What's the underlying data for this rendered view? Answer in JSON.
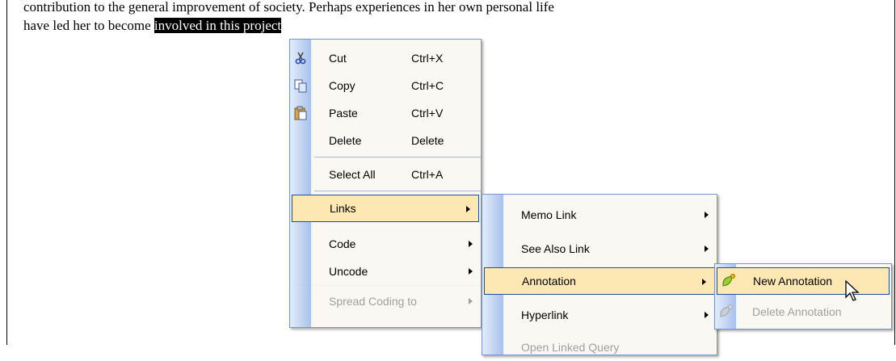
{
  "document": {
    "line1": "contribution to the general improvement of society. Perhaps experiences in her own personal life",
    "line2_before": "have led her to become ",
    "line2_highlight": "involved in",
    "line2_hidden": " this project"
  },
  "context_menu": {
    "items": [
      {
        "label": "Cut",
        "shortcut": "Ctrl+X",
        "icon": "scissors-icon"
      },
      {
        "label": "Copy",
        "shortcut": "Ctrl+C",
        "icon": "copy-icon"
      },
      {
        "label": "Paste",
        "shortcut": "Ctrl+V",
        "icon": "paste-icon"
      },
      {
        "label": "Delete",
        "shortcut": "Delete"
      },
      {
        "label": "Select All",
        "shortcut": "Ctrl+A"
      },
      {
        "label": "Links"
      },
      {
        "label": "Code"
      },
      {
        "label": "Uncode"
      },
      {
        "label": "Spread Coding to"
      }
    ]
  },
  "links_submenu": {
    "items": [
      {
        "label": "Memo Link"
      },
      {
        "label": "See Also Link"
      },
      {
        "label": "Annotation"
      },
      {
        "label": "Hyperlink"
      },
      {
        "label": "Open Linked Query"
      }
    ]
  },
  "annotation_submenu": {
    "items": [
      {
        "label": "New Annotation",
        "icon": "new-annotation-icon"
      },
      {
        "label": "Delete Annotation",
        "icon": "delete-annotation-icon"
      }
    ]
  },
  "colors": {
    "menu_background": "#f9f8f3",
    "menu_border": "#7a96d4",
    "selection_fill": "#fde8b4",
    "selection_border": "#1f4fa5",
    "disabled_text": "#a0a0a0"
  }
}
